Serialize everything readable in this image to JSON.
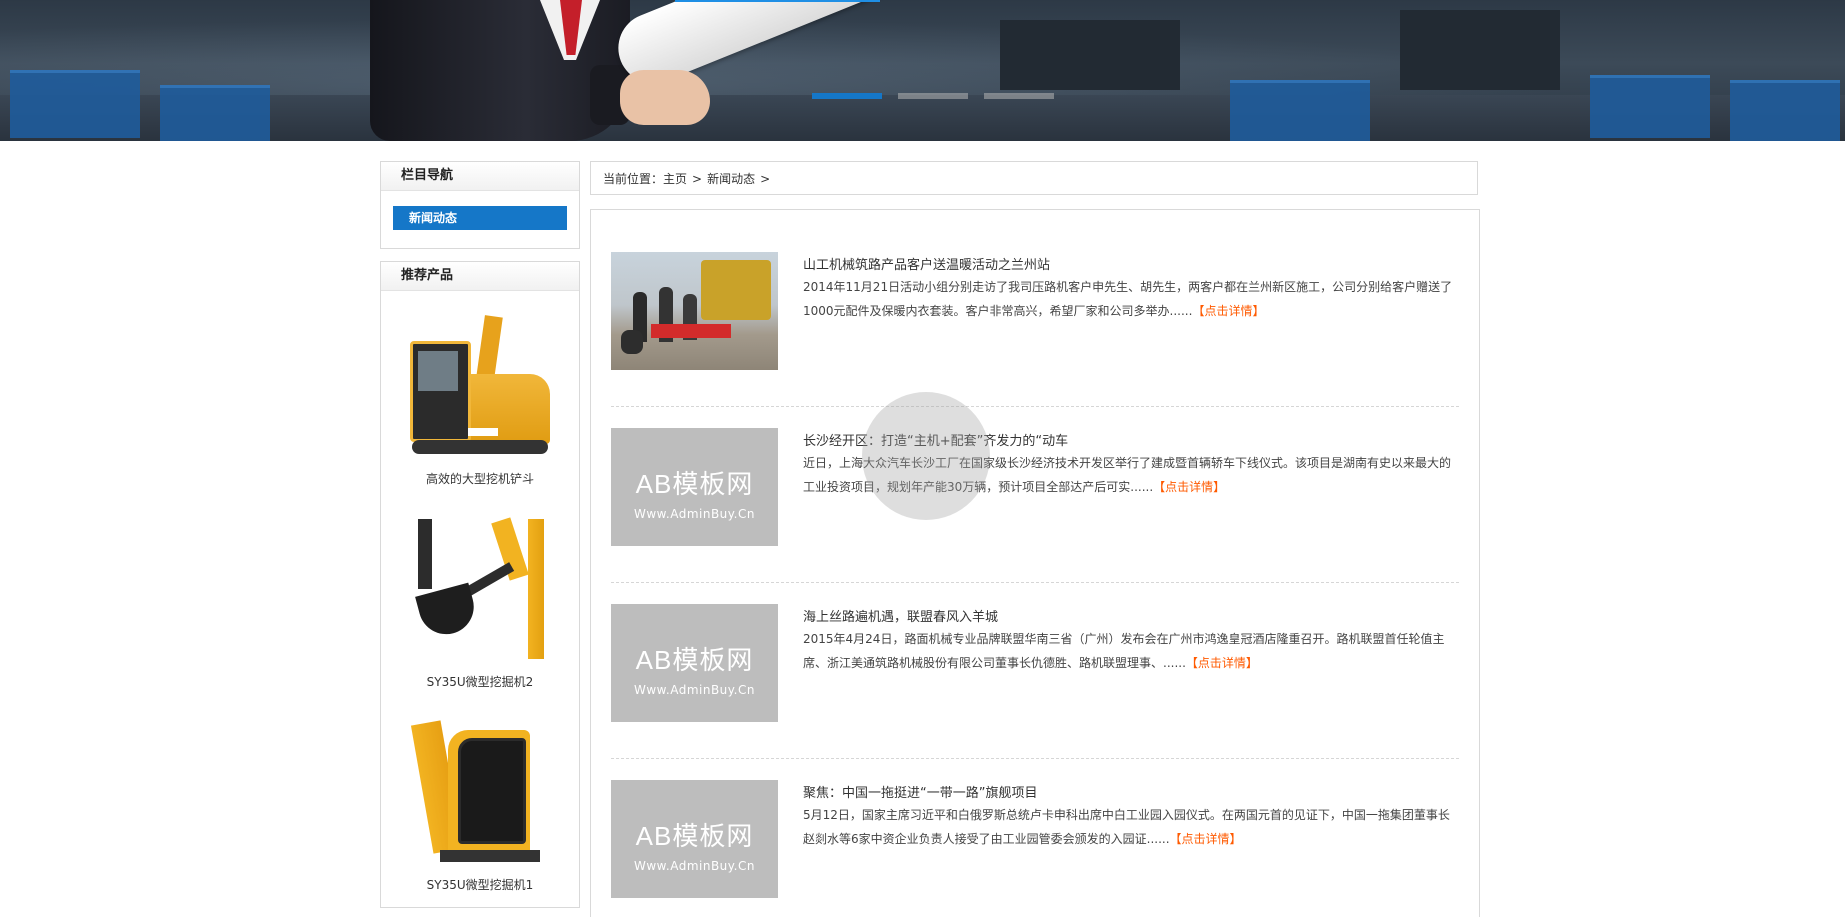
{
  "banner": {
    "slides": 3,
    "active_slide": 1
  },
  "sidebar": {
    "nav_title": "栏目导航",
    "nav_items": [
      {
        "label": "新闻动态",
        "active": true
      }
    ],
    "products_title": "推荐产品",
    "products": [
      {
        "name": "高效的大型挖机铲斗"
      },
      {
        "name": "SY35U微型挖掘机2"
      },
      {
        "name": "SY35U微型挖掘机1"
      }
    ]
  },
  "breadcrumb": {
    "prefix": "当前位置：",
    "home": "主页",
    "section": "新闻动态",
    "separator": ">"
  },
  "news": [
    {
      "title": "山工机械筑路产品客户送温暖活动之兰州站",
      "summary": "2014年11月21日活动小组分别走访了我司压路机客户申先生、胡先生，两客户都在兰州新区施工，公司分别给客户赠送了1000元配件及保暖内衣套装。客户非常高兴，希望厂家和公司多举办......",
      "more": "【点击详情】",
      "image": "photo"
    },
    {
      "title": "长沙经开区：打造“主机+配套”齐发力的“动车",
      "summary": "近日，上海大众汽车长沙工厂在国家级长沙经济技术开发区举行了建成暨首辆轿车下线仪式。该项目是湖南有史以来最大的工业投资项目，规划年产能30万辆，预计项目全部达产后可实......",
      "more": "【点击详情】",
      "image": "placeholder"
    },
    {
      "title": "海上丝路遍机遇，联盟春风入羊城",
      "summary": "2015年4月24日，路面机械专业品牌联盟华南三省（广州）发布会在广州市鸿逸皇冠酒店隆重召开。路机联盟首任轮值主席、浙江美通筑路机械股份有限公司董事长仇德胜、路机联盟理事、......",
      "more": "【点击详情】",
      "image": "placeholder"
    },
    {
      "title": "聚焦：中国一拖挺进“一带一路”旗舰项目",
      "summary": "5月12日，国家主席习近平和白俄罗斯总统卢卡申科出席中白工业园入园仪式。在两国元首的见证下，中国一拖集团董事长赵剡水等6家中资企业负责人接受了由工业园管委会颁发的入园证......",
      "more": "【点击详情】",
      "image": "placeholder"
    }
  ],
  "placeholder_image": {
    "big": "AB模板网",
    "small": "Www.AdminBuy.Cn"
  },
  "colors": {
    "accent": "#1577c8",
    "more_link": "#ff5a00",
    "border": "#d9d9d9"
  }
}
